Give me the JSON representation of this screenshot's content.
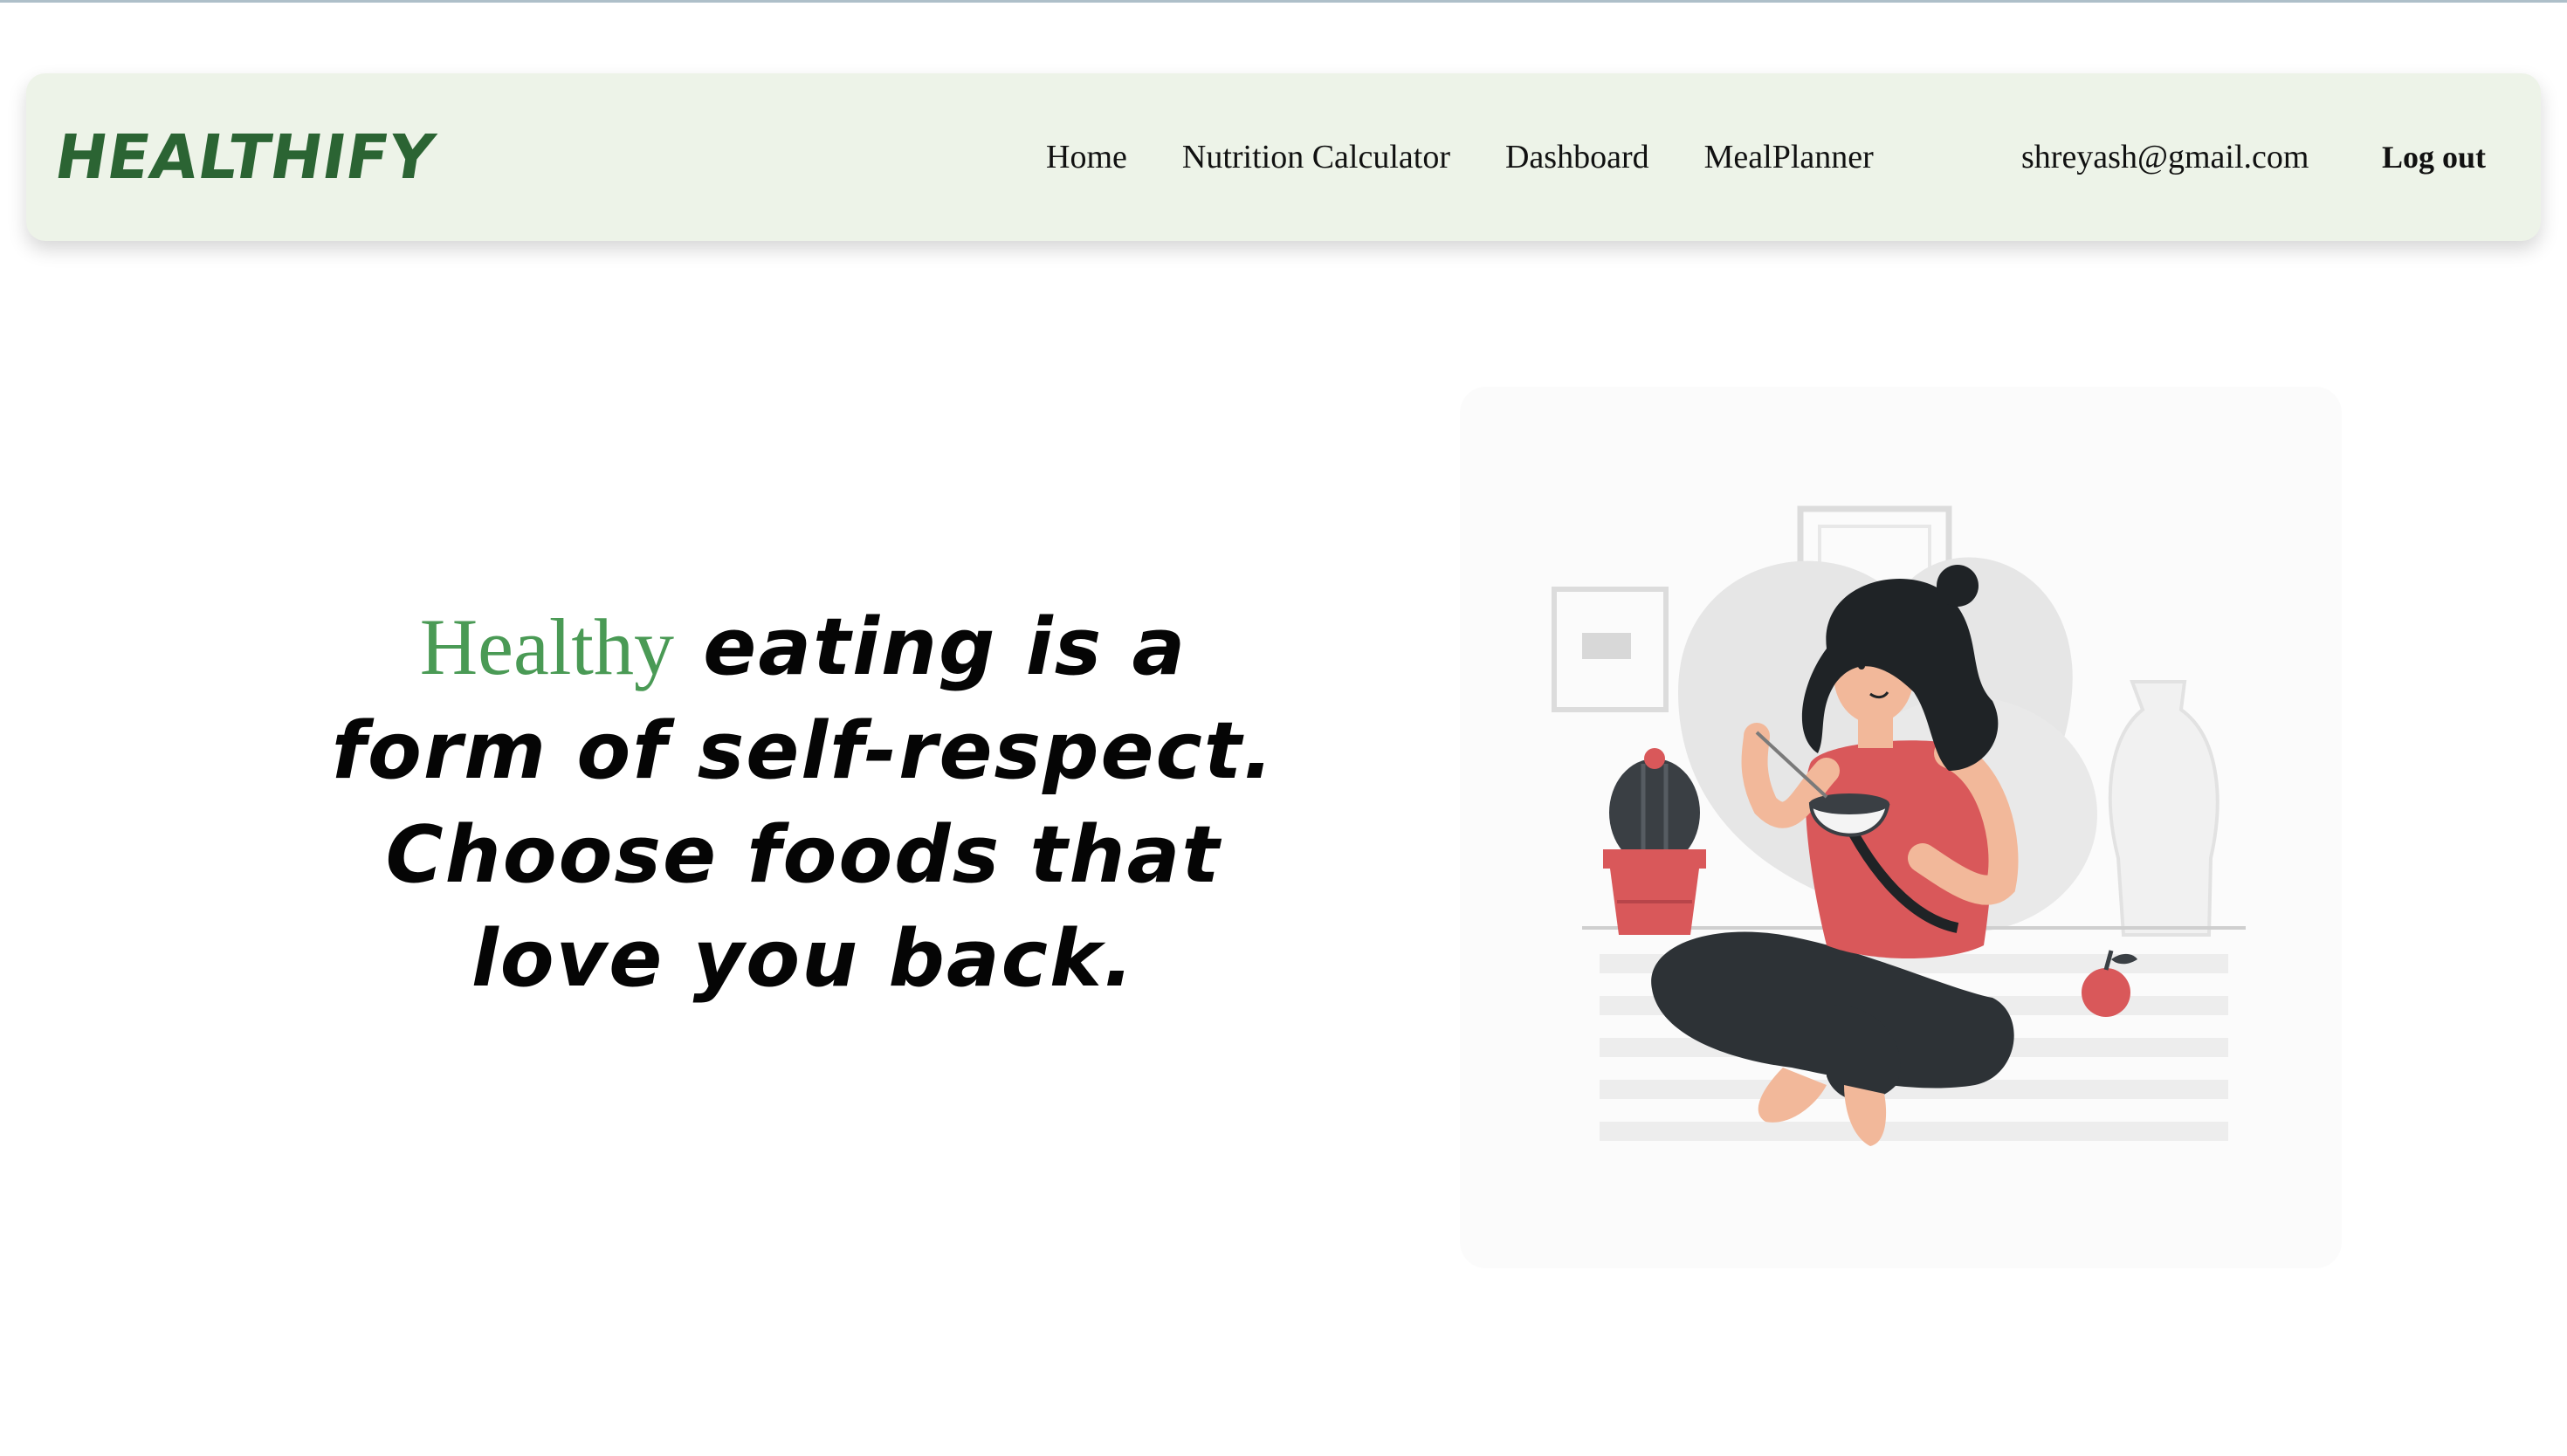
{
  "brand": {
    "name": "HEALTHIFY",
    "color": "#2b6433"
  },
  "nav": {
    "links": [
      "Home",
      "Nutrition Calculator",
      "Dashboard",
      "MealPlanner"
    ],
    "user_email": "shreyash@gmail.com",
    "logout_label": "Log out",
    "background": "#edf3e8"
  },
  "hero": {
    "accent_word": "Healthy",
    "rest": " eating is a form of self-respect. Choose foods that love you back.",
    "accent_color": "#4a9a55"
  },
  "illustration": {
    "subject": "woman-eating-bowl-illustration",
    "accent_color": "#d9585a"
  }
}
